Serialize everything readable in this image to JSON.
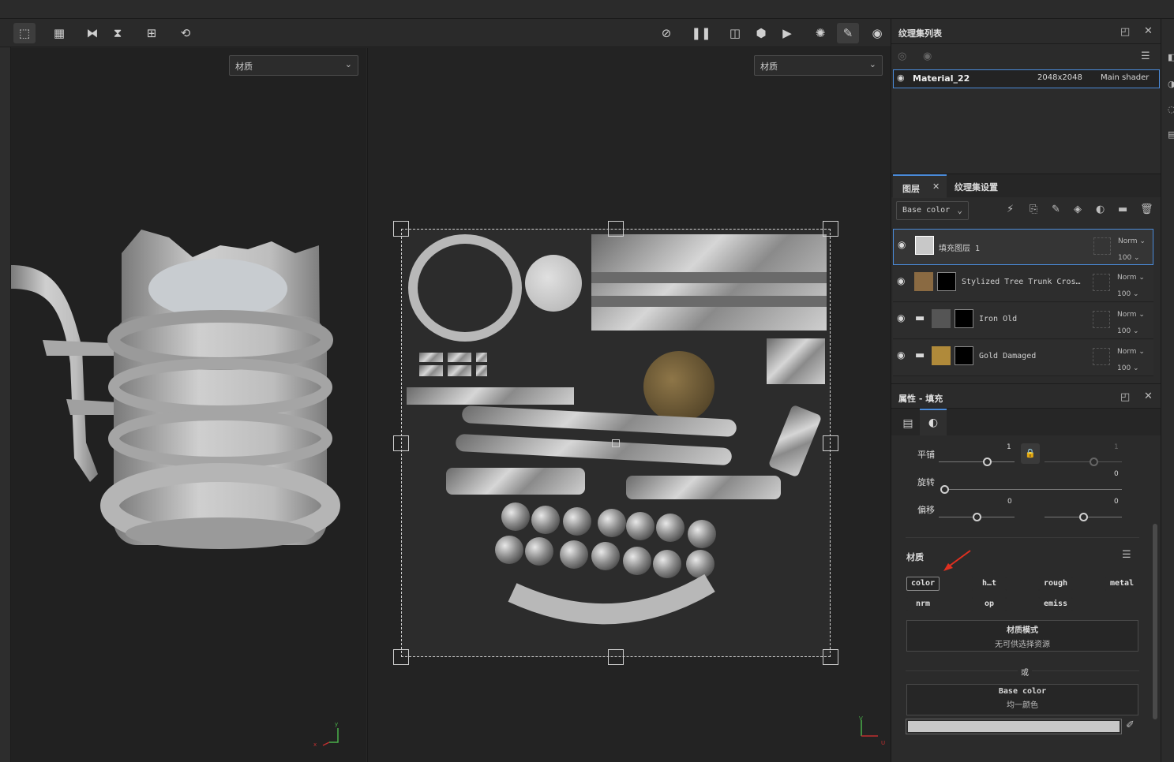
{
  "toolbar": {
    "left_icons": [
      "select-icon",
      "grid-icon",
      "mirror-x-icon",
      "mirror-y-icon",
      "add-frame-icon",
      "reset-view-icon"
    ],
    "right_icons": [
      "uv-hide-icon",
      "pause-icon",
      "split-view-icon",
      "cube-icon",
      "camera-video-icon",
      "particles-icon",
      "brush-icon",
      "screenshot-icon"
    ]
  },
  "viewport3d": {
    "material_select": "材质",
    "axis": {
      "x": "x",
      "y": "y",
      "z": "z"
    }
  },
  "viewportuv": {
    "material_select": "材质",
    "axis": {
      "v": "V",
      "u": "U"
    }
  },
  "textureset_panel": {
    "title": "纹理集列表",
    "material": {
      "name": "Material_22",
      "resolution": "2048x2048",
      "shader": "Main shader"
    }
  },
  "layers_panel": {
    "tabs": [
      "图层",
      "纹理集设置"
    ],
    "channel_select": "Base color",
    "layers": [
      {
        "name": "填充图层 1",
        "blend": "Norm",
        "opacity": "100",
        "selected": true
      },
      {
        "name": "Stylized Tree Trunk Cros…",
        "blend": "Norm",
        "opacity": "100"
      },
      {
        "name": "Iron Old",
        "blend": "Norm",
        "opacity": "100"
      },
      {
        "name": "Gold Damaged",
        "blend": "Norm",
        "opacity": "100"
      }
    ]
  },
  "properties_panel": {
    "title": "属性 - 填充",
    "tiling_label": "平铺",
    "tiling_value": "1",
    "tiling_value2": "1",
    "rotation_label": "旋转",
    "rotation_value": "0",
    "offset_label": "偏移",
    "offset_value_1": "0",
    "offset_value_2": "0",
    "material_label": "材质",
    "channel_buttons": [
      "color",
      "h…t",
      "rough",
      "metal",
      "nrm",
      "op",
      "emiss"
    ],
    "material_mode_title": "材质模式",
    "material_mode_sub": "无可供选择资源",
    "or_label": "或",
    "base_color_title": "Base color",
    "base_color_sub": "均一颜色",
    "base_color_swatch": "#c8c8c8"
  },
  "colors": {
    "accent": "#4a8ad8",
    "arrow": "#e03020"
  }
}
